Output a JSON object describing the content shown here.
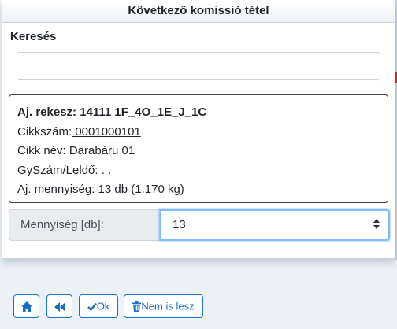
{
  "dialog": {
    "title": "Következő komissió tétel"
  },
  "search": {
    "label": "Keresés",
    "value": "",
    "placeholder": ""
  },
  "item": {
    "title": "Aj. rekesz: 14111 1F_4O_1E_J_1C",
    "article_label": "Cikkszám:",
    "article_value": " 0001000101",
    "name_line": "Cikk név: Darabáru 01",
    "lot_line": "GySzám/Leldő: . .",
    "qty_line": "Aj. mennyiség: 13 db (1.170 kg)"
  },
  "quantity": {
    "label": "Mennyiség [db]:",
    "value": "13"
  },
  "toolbar": {
    "home_icon": "home-icon",
    "back_icon": "rewind-icon",
    "ok_label": "Ok",
    "ok_icon": "check-icon",
    "cancel_label": "Nem is lesz",
    "cancel_icon": "trash-icon"
  },
  "colors": {
    "accent": "#1a6fc2",
    "focus": "#80bdff",
    "background": "#eaf1f8"
  }
}
